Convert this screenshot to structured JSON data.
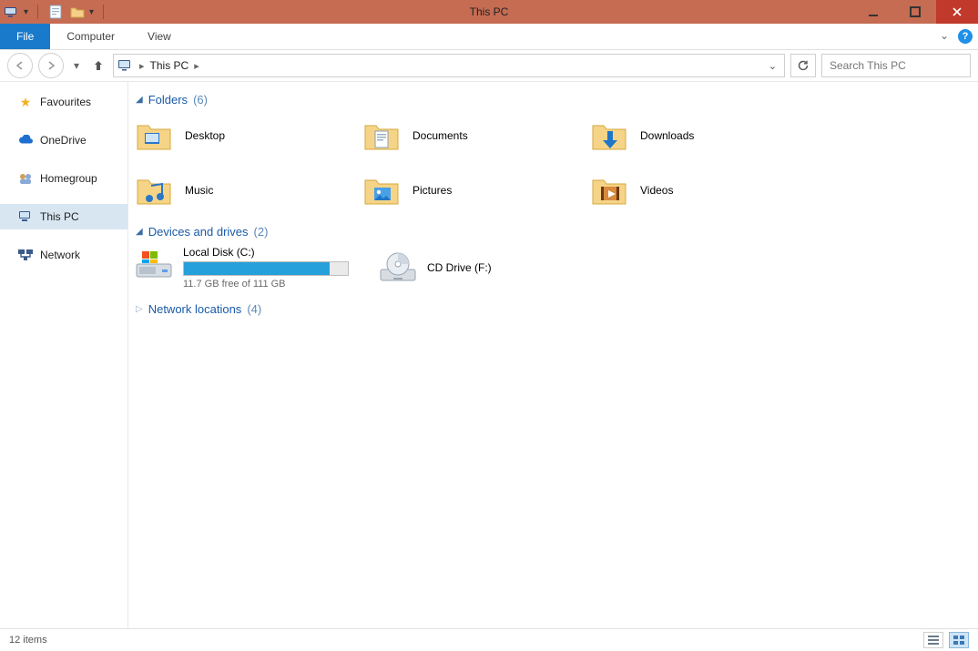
{
  "titlebar": {
    "title": "This PC"
  },
  "ribbon": {
    "file": "File",
    "tabs": [
      "Computer",
      "View"
    ]
  },
  "address": {
    "location": "This PC",
    "search_placeholder": "Search This PC"
  },
  "sidebar": {
    "items": [
      {
        "label": "Favourites",
        "icon": "star"
      },
      {
        "label": "OneDrive",
        "icon": "cloud"
      },
      {
        "label": "Homegroup",
        "icon": "homegroup"
      },
      {
        "label": "This PC",
        "icon": "pc",
        "selected": true
      },
      {
        "label": "Network",
        "icon": "network"
      }
    ]
  },
  "groups": {
    "folders": {
      "title": "Folders",
      "count": "(6)",
      "expanded": true
    },
    "drives": {
      "title": "Devices and drives",
      "count": "(2)",
      "expanded": true
    },
    "network": {
      "title": "Network locations",
      "count": "(4)",
      "expanded": false
    }
  },
  "folders": [
    {
      "label": "Desktop"
    },
    {
      "label": "Documents"
    },
    {
      "label": "Downloads"
    },
    {
      "label": "Music"
    },
    {
      "label": "Pictures"
    },
    {
      "label": "Videos"
    }
  ],
  "drives": [
    {
      "label": "Local Disk (C:)",
      "free_text": "11.7 GB free of 111 GB",
      "fill_pct": 89
    },
    {
      "label": "CD Drive (F:)"
    }
  ],
  "status": {
    "items_text": "12 items"
  }
}
